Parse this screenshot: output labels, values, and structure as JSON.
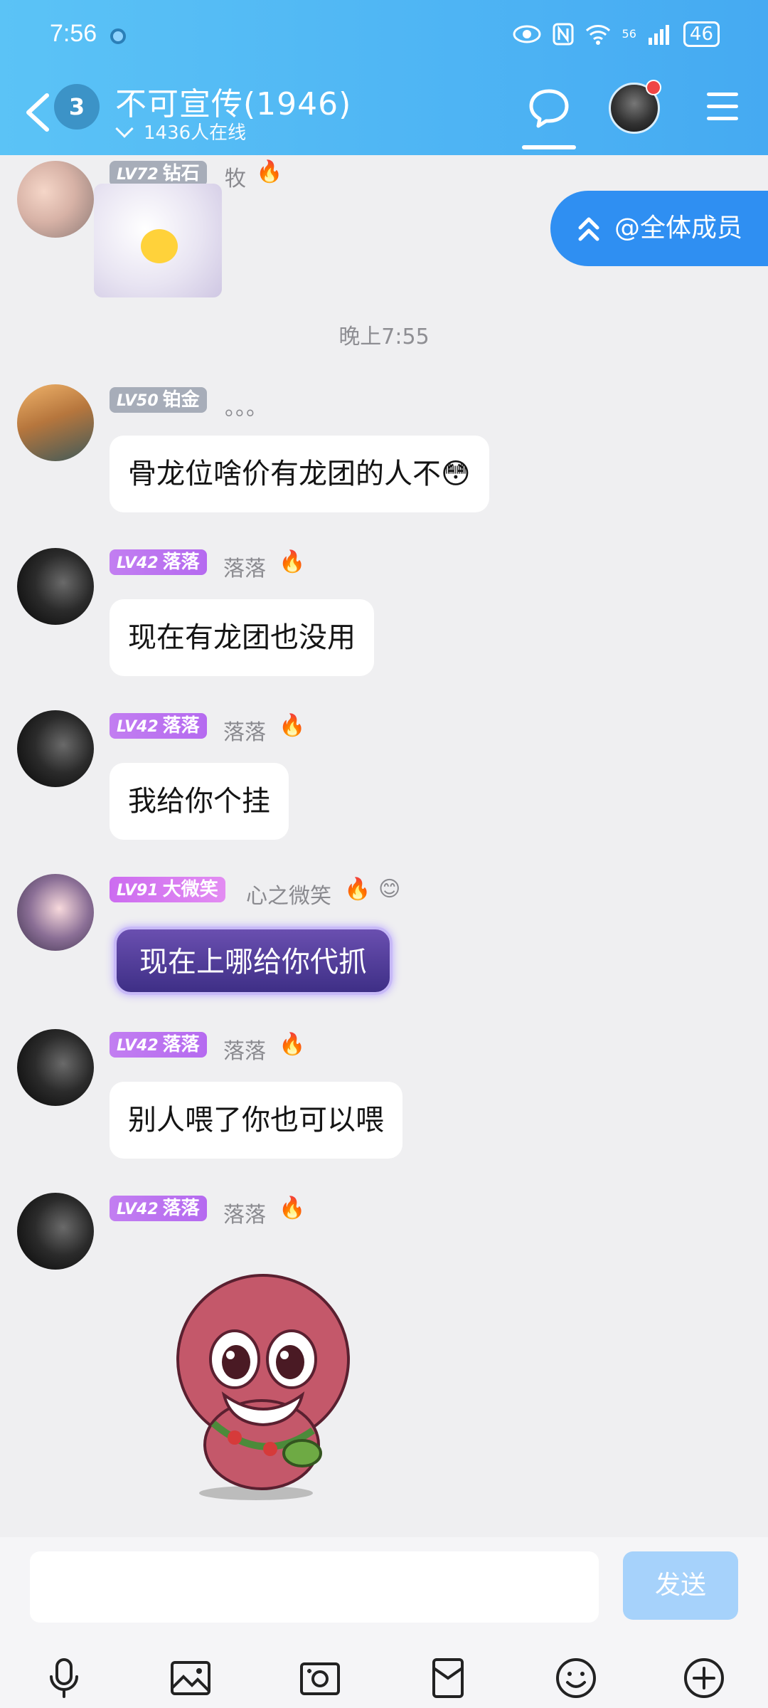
{
  "status_bar": {
    "time": "7:56",
    "network": "56",
    "battery": "46"
  },
  "header": {
    "back_count": "3",
    "title": "不可宣传(1946)",
    "online": "1436人在线"
  },
  "at_all": "@全体成员",
  "messages": [
    {
      "level": "LV72",
      "rank": "钻石",
      "nickname": "牧",
      "fire": "🔥"
    },
    {
      "time_divider": "晚上7:55"
    },
    {
      "level": "LV50",
      "rank": "铂金",
      "nickname": "。。。",
      "text": "骨龙位啥价有龙团的人不😳"
    },
    {
      "level": "LV42",
      "rank": "落落",
      "nickname": "落落",
      "fire": "🔥",
      "text": "现在有龙团也没用"
    },
    {
      "level": "LV42",
      "rank": "落落",
      "nickname": "落落",
      "fire": "🔥",
      "text": "我给你个挂"
    },
    {
      "level": "LV91",
      "rank": "大微笑",
      "nickname": "心之微笑",
      "fire": "🔥",
      "emoji": "😊",
      "text": "现在上哪给你代抓"
    },
    {
      "level": "LV42",
      "rank": "落落",
      "nickname": "落落",
      "fire": "🔥",
      "text": "别人喂了你也可以喂"
    },
    {
      "level": "LV42",
      "rank": "落落",
      "nickname": "落落",
      "fire": "🔥"
    }
  ],
  "input": {
    "value": "",
    "send_label": "发送"
  },
  "toolbar_icons": [
    "microphone-icon",
    "image-icon",
    "camera-icon",
    "red-packet-icon",
    "emoji-icon",
    "plus-icon"
  ]
}
